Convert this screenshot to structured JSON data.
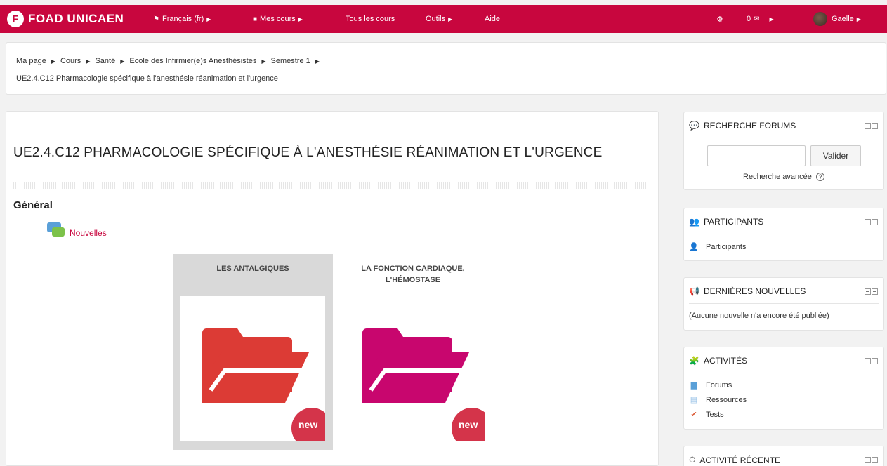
{
  "navbar": {
    "brand_logo": "F",
    "brand": "FOAD UNICAEN",
    "items": [
      {
        "label": "Français (fr)",
        "icon": "flag-icon"
      },
      {
        "label": "Mes cours",
        "icon": "briefcase-icon"
      },
      {
        "label": "Tous les cours"
      },
      {
        "label": "Outils"
      },
      {
        "label": "Aide"
      }
    ],
    "notifications_glyph": "⚙",
    "messages_count": "0",
    "user": "Gaelle",
    "colors": {
      "bar": "#c8063e"
    }
  },
  "breadcrumb": {
    "items": [
      "Ma page",
      "Cours",
      "Santé",
      "Ecole des Infirmier(e)s Anesthésistes",
      "Semestre 1"
    ],
    "current": "UE2.4.C12 Pharmacologie spécifique à l'anesthésie réanimation et l'urgence"
  },
  "course": {
    "title": "UE2.4.C12 PHARMACOLOGIE SPÉCIFIQUE À L'ANESTHÉSIE RÉANIMATION ET L'URGENCE",
    "section_title": "Général",
    "news_link": "Nouvelles",
    "tiles": [
      {
        "title": "LES ANTALGIQUES",
        "badge": "new",
        "folder_color": "#dc3b35",
        "active": true
      },
      {
        "title": "LA FONCTION CARDIAQUE, L'HÉMOSTASE",
        "badge": "new",
        "folder_color": "#c8066e",
        "active": false
      }
    ]
  },
  "blocks": {
    "search_forums": {
      "title": "RECHERCHE FORUMS",
      "button": "Valider",
      "advanced": "Recherche avancée",
      "help": "?"
    },
    "participants": {
      "title": "PARTICIPANTS",
      "item": "Participants"
    },
    "news": {
      "title": "DERNIÈRES NOUVELLES",
      "empty": "(Aucune nouvelle n'a encore été publiée)"
    },
    "activities": {
      "title": "ACTIVITÉS",
      "items": [
        "Forums",
        "Ressources",
        "Tests"
      ]
    },
    "recent": {
      "title": "ACTIVITÉ RÉCENTE"
    }
  }
}
